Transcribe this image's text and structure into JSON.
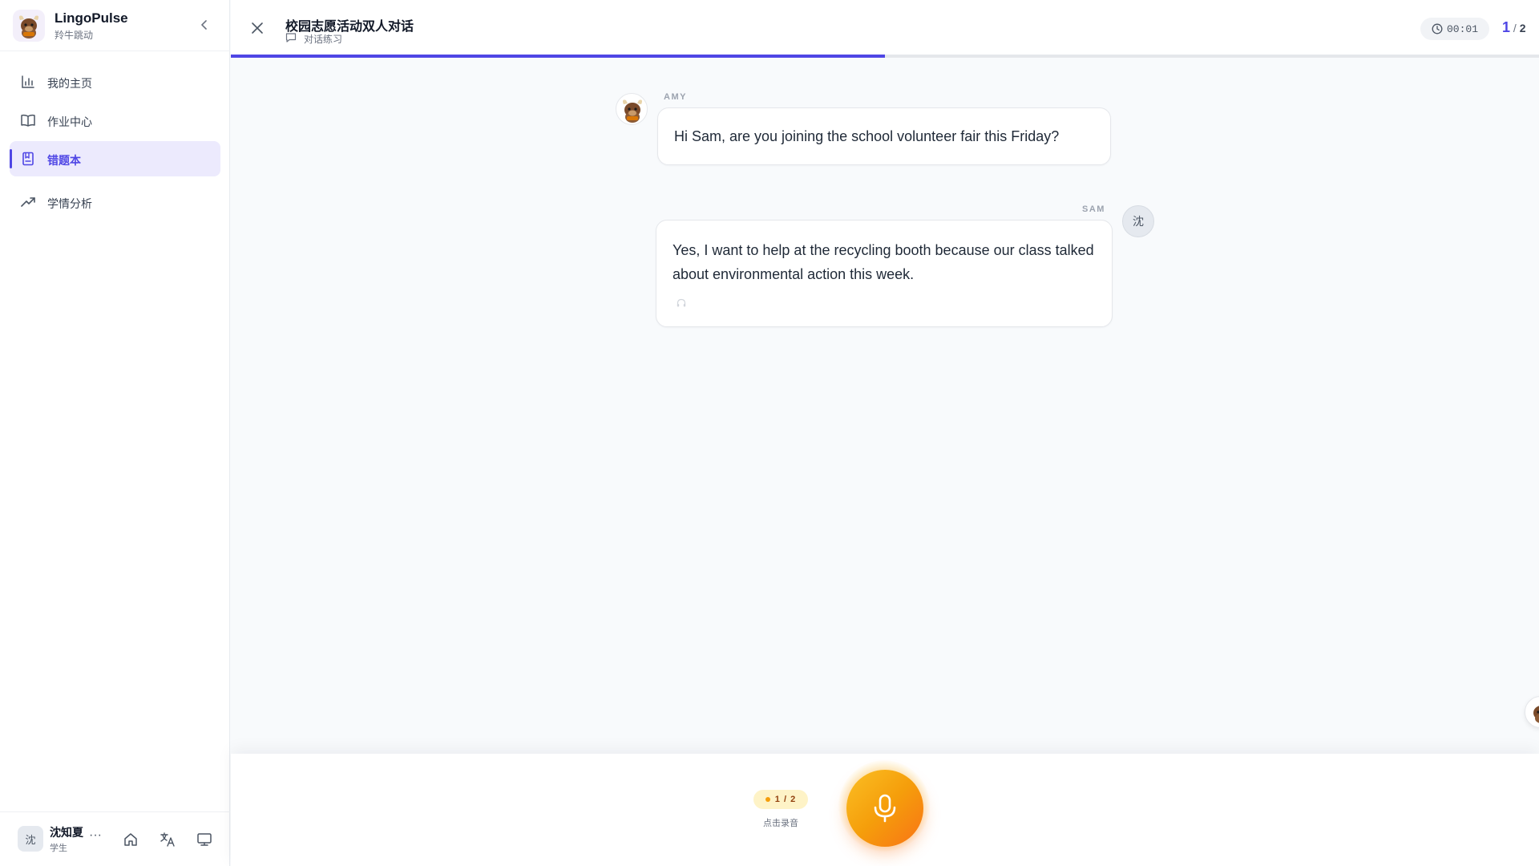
{
  "app": {
    "name": "LingoPulse",
    "subtitle": "羚牛跳动"
  },
  "nav": {
    "items": [
      {
        "label": "我的主页",
        "icon": "bar-chart-icon",
        "active": false
      },
      {
        "label": "作业中心",
        "icon": "open-book-icon",
        "active": false
      },
      {
        "label": "错题本",
        "icon": "notebook-icon",
        "active": true
      },
      {
        "label": "学情分析",
        "icon": "trending-up-icon",
        "active": false
      }
    ]
  },
  "user": {
    "initial": "沈",
    "name": "沈知夏",
    "role": "学生",
    "more": "···"
  },
  "task": {
    "title": "校园志愿活动双人对话",
    "type": "对话练习",
    "timer": "00:01",
    "current": "1",
    "separator": "/",
    "total": "2",
    "progress": 0.5
  },
  "dialogue": [
    {
      "speaker": "AMY",
      "text": "Hi Sam, are you joining the school volunteer fair this Friday?"
    },
    {
      "speaker": "SAM",
      "avatar_initial": "沈",
      "text": "Yes, I want to help at the recycling booth because our class talked about environmental action this week."
    }
  ],
  "recorder": {
    "round": "1 / 2",
    "hint": "点击录音"
  },
  "colors": {
    "accent": "#4f46e5",
    "active_nav_bg": "#eceafd",
    "mic_start": "#fbbf24",
    "mic_end": "#f97316"
  }
}
